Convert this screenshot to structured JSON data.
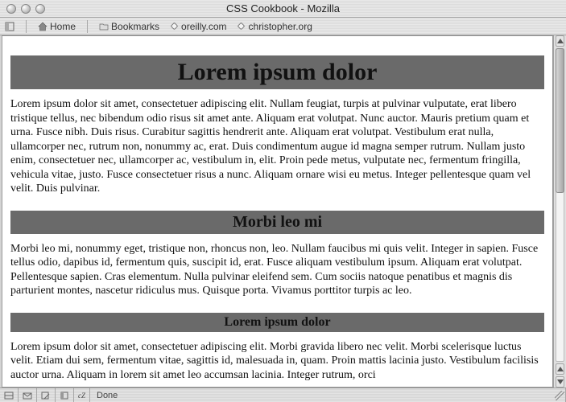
{
  "window": {
    "title": "CSS Cookbook - Mozilla"
  },
  "toolbar": {
    "home": "Home",
    "bookmarks": "Bookmarks",
    "links": [
      "oreilly.com",
      "christopher.org"
    ]
  },
  "page": {
    "sections": [
      {
        "heading": "Lorem ipsum dolor",
        "level": "h1",
        "body": "Lorem ipsum dolor sit amet, consectetuer adipiscing elit. Nullam feugiat, turpis at pulvinar vulputate, erat libero tristique tellus, nec bibendum odio risus sit amet ante. Aliquam erat volutpat. Nunc auctor. Mauris pretium quam et urna. Fusce nibh. Duis risus. Curabitur sagittis hendrerit ante. Aliquam erat volutpat. Vestibulum erat nulla, ullamcorper nec, rutrum non, nonummy ac, erat. Duis condimentum augue id magna semper rutrum. Nullam justo enim, consectetuer nec, ullamcorper ac, vestibulum in, elit. Proin pede metus, vulputate nec, fermentum fringilla, vehicula vitae, justo. Fusce consectetuer risus a nunc. Aliquam ornare wisi eu metus. Integer pellentesque quam vel velit. Duis pulvinar."
      },
      {
        "heading": "Morbi leo mi",
        "level": "h2",
        "body": "Morbi leo mi, nonummy eget, tristique non, rhoncus non, leo. Nullam faucibus mi quis velit. Integer in sapien. Fusce tellus odio, dapibus id, fermentum quis, suscipit id, erat. Fusce aliquam vestibulum ipsum. Aliquam erat volutpat. Pellentesque sapien. Cras elementum. Nulla pulvinar eleifend sem. Cum sociis natoque penatibus et magnis dis parturient montes, nascetur ridiculus mus. Quisque porta. Vivamus porttitor turpis ac leo."
      },
      {
        "heading": "Lorem ipsum dolor",
        "level": "h3",
        "body": "Lorem ipsum dolor sit amet, consectetuer adipiscing elit. Morbi gravida libero nec velit. Morbi scelerisque luctus velit. Etiam dui sem, fermentum vitae, sagittis id, malesuada in, quam. Proin mattis lacinia justo. Vestibulum facilisis auctor urna. Aliquam in lorem sit amet leo accumsan lacinia. Integer rutrum, orci"
      }
    ]
  },
  "statusbar": {
    "text": "Done"
  }
}
